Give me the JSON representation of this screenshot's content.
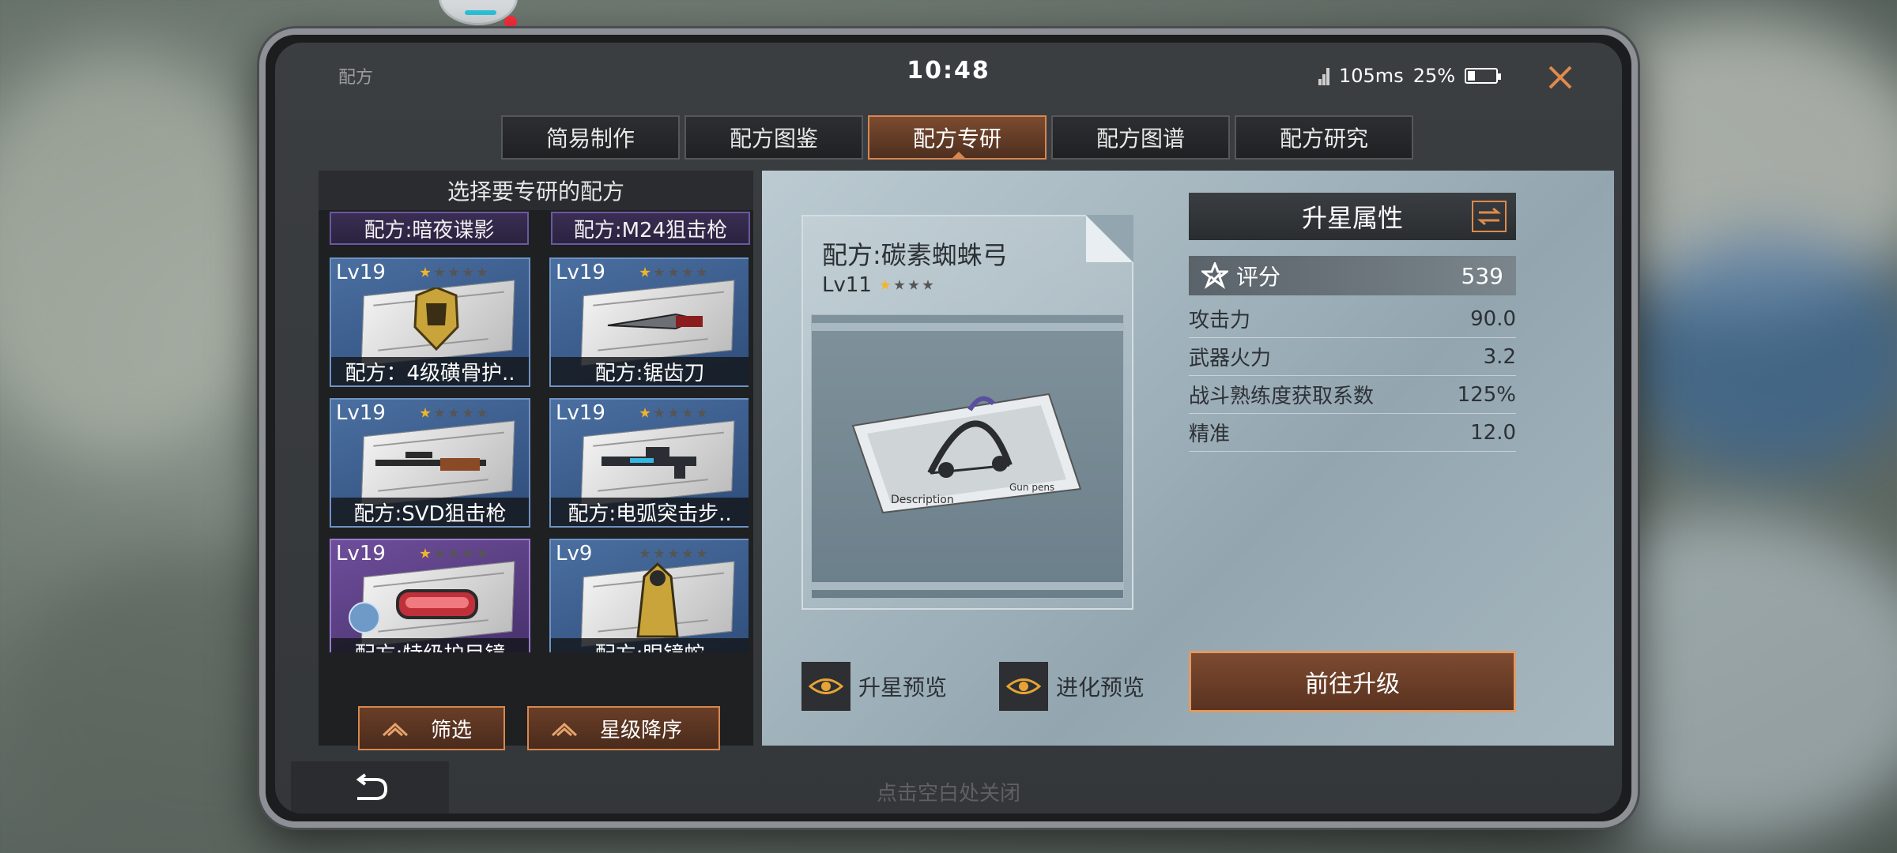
{
  "status": {
    "title": "配方",
    "time": "10:48",
    "ping": "105ms",
    "battery": "25%",
    "battery_level": 0.25
  },
  "tabs": [
    {
      "label": "简易制作",
      "active": false
    },
    {
      "label": "配方图鉴",
      "active": false
    },
    {
      "label": "配方专研",
      "active": true
    },
    {
      "label": "配方图谱",
      "active": false
    },
    {
      "label": "配方研究",
      "active": false
    }
  ],
  "left": {
    "heading": "选择要专研的配方",
    "top_items": [
      "配方:暗夜谍影",
      "配方:M24狙击枪"
    ],
    "cards": [
      {
        "level": "Lv19",
        "stars_on": 1,
        "name": "配方：4级磺骨护..",
        "color": "blue",
        "icon": "armor-icon"
      },
      {
        "level": "Lv19",
        "stars_on": 1,
        "name": "配方:锯齿刀",
        "color": "blue",
        "icon": "knife-icon"
      },
      {
        "level": "Lv19",
        "stars_on": 1,
        "name": "配方:SVD狙击枪",
        "color": "blue",
        "icon": "sniper-rifle-icon"
      },
      {
        "level": "Lv19",
        "stars_on": 1,
        "name": "配方:电弧突击步..",
        "color": "blue",
        "icon": "assault-rifle-icon"
      },
      {
        "level": "Lv19",
        "stars_on": 1,
        "name": "配方:特级护目镜",
        "color": "purple",
        "icon": "goggles-icon"
      },
      {
        "level": "Lv9",
        "stars_on": 0,
        "name": "配方:眼镜蛇",
        "color": "blue",
        "icon": "cloak-icon"
      }
    ],
    "filter_label": "筛选",
    "sort_label": "星级降序"
  },
  "detail": {
    "title": "配方:碳素蜘蛛弓",
    "level": "Lv11",
    "stars_on": 1,
    "stars_total": 4,
    "image_icon": "bow-icon",
    "paper_label_1": "Description",
    "paper_label_2": "Gun pens"
  },
  "attributes": {
    "header": "升星属性",
    "score_label": "评分",
    "score_value": "539",
    "rows": [
      {
        "label": "攻击力",
        "value": "90.0"
      },
      {
        "label": "武器火力",
        "value": "3.2"
      },
      {
        "label": "战斗熟练度获取系数",
        "value": "125%"
      },
      {
        "label": "精准",
        "value": "12.0"
      }
    ]
  },
  "actions": {
    "star_preview": "升星预览",
    "evolve_preview": "进化预览",
    "upgrade": "前往升级"
  },
  "bottom": {
    "hint": "点击空白处关闭"
  },
  "colors": {
    "accent_orange": "#d7874f",
    "card_blue": "#4a6fa0",
    "card_purple": "#6e4e9a",
    "star_gold": "#f1b52a"
  }
}
